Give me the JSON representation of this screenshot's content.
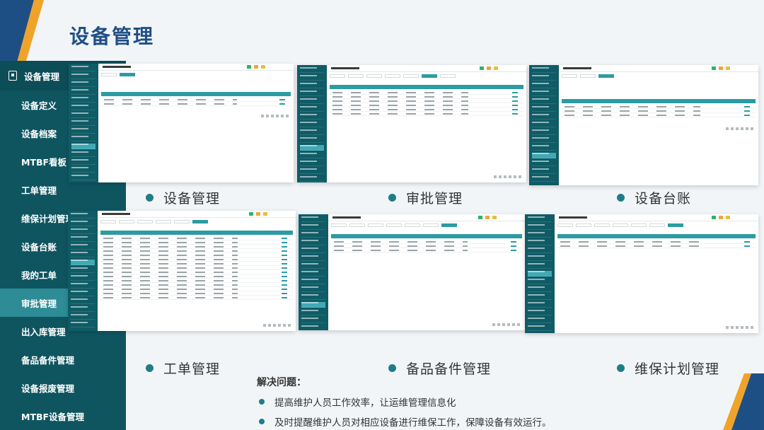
{
  "page_title": "设备管理",
  "nav": {
    "header": "设备管理",
    "items": [
      "设备定义",
      "设备档案",
      "MTBF看板",
      "工单管理",
      "维保计划管理",
      "设备台账",
      "我的工单",
      "审批管理",
      "出入库管理",
      "备品备件管理",
      "设备报废管理",
      "MTBF设备管理"
    ],
    "active_index": 7
  },
  "captions": {
    "c1": "设备管理",
    "c2": "审批管理",
    "c3": "设备台账",
    "c4": "工单管理",
    "c5": "备品备件管理",
    "c6": "维保计划管理"
  },
  "solve": {
    "title": "解决问题：",
    "points": [
      "提高维护人员工作效率，让运维管理信息化",
      "及时提醒维护人员对相应设备进行维保工作，保障设备有效运行。"
    ]
  },
  "colors": {
    "nav_bg": "#0f5560",
    "nav_active": "#2d8c96",
    "title": "#1f4f86",
    "accent": "#1f7d87",
    "table_head": "#2c9ba3"
  }
}
